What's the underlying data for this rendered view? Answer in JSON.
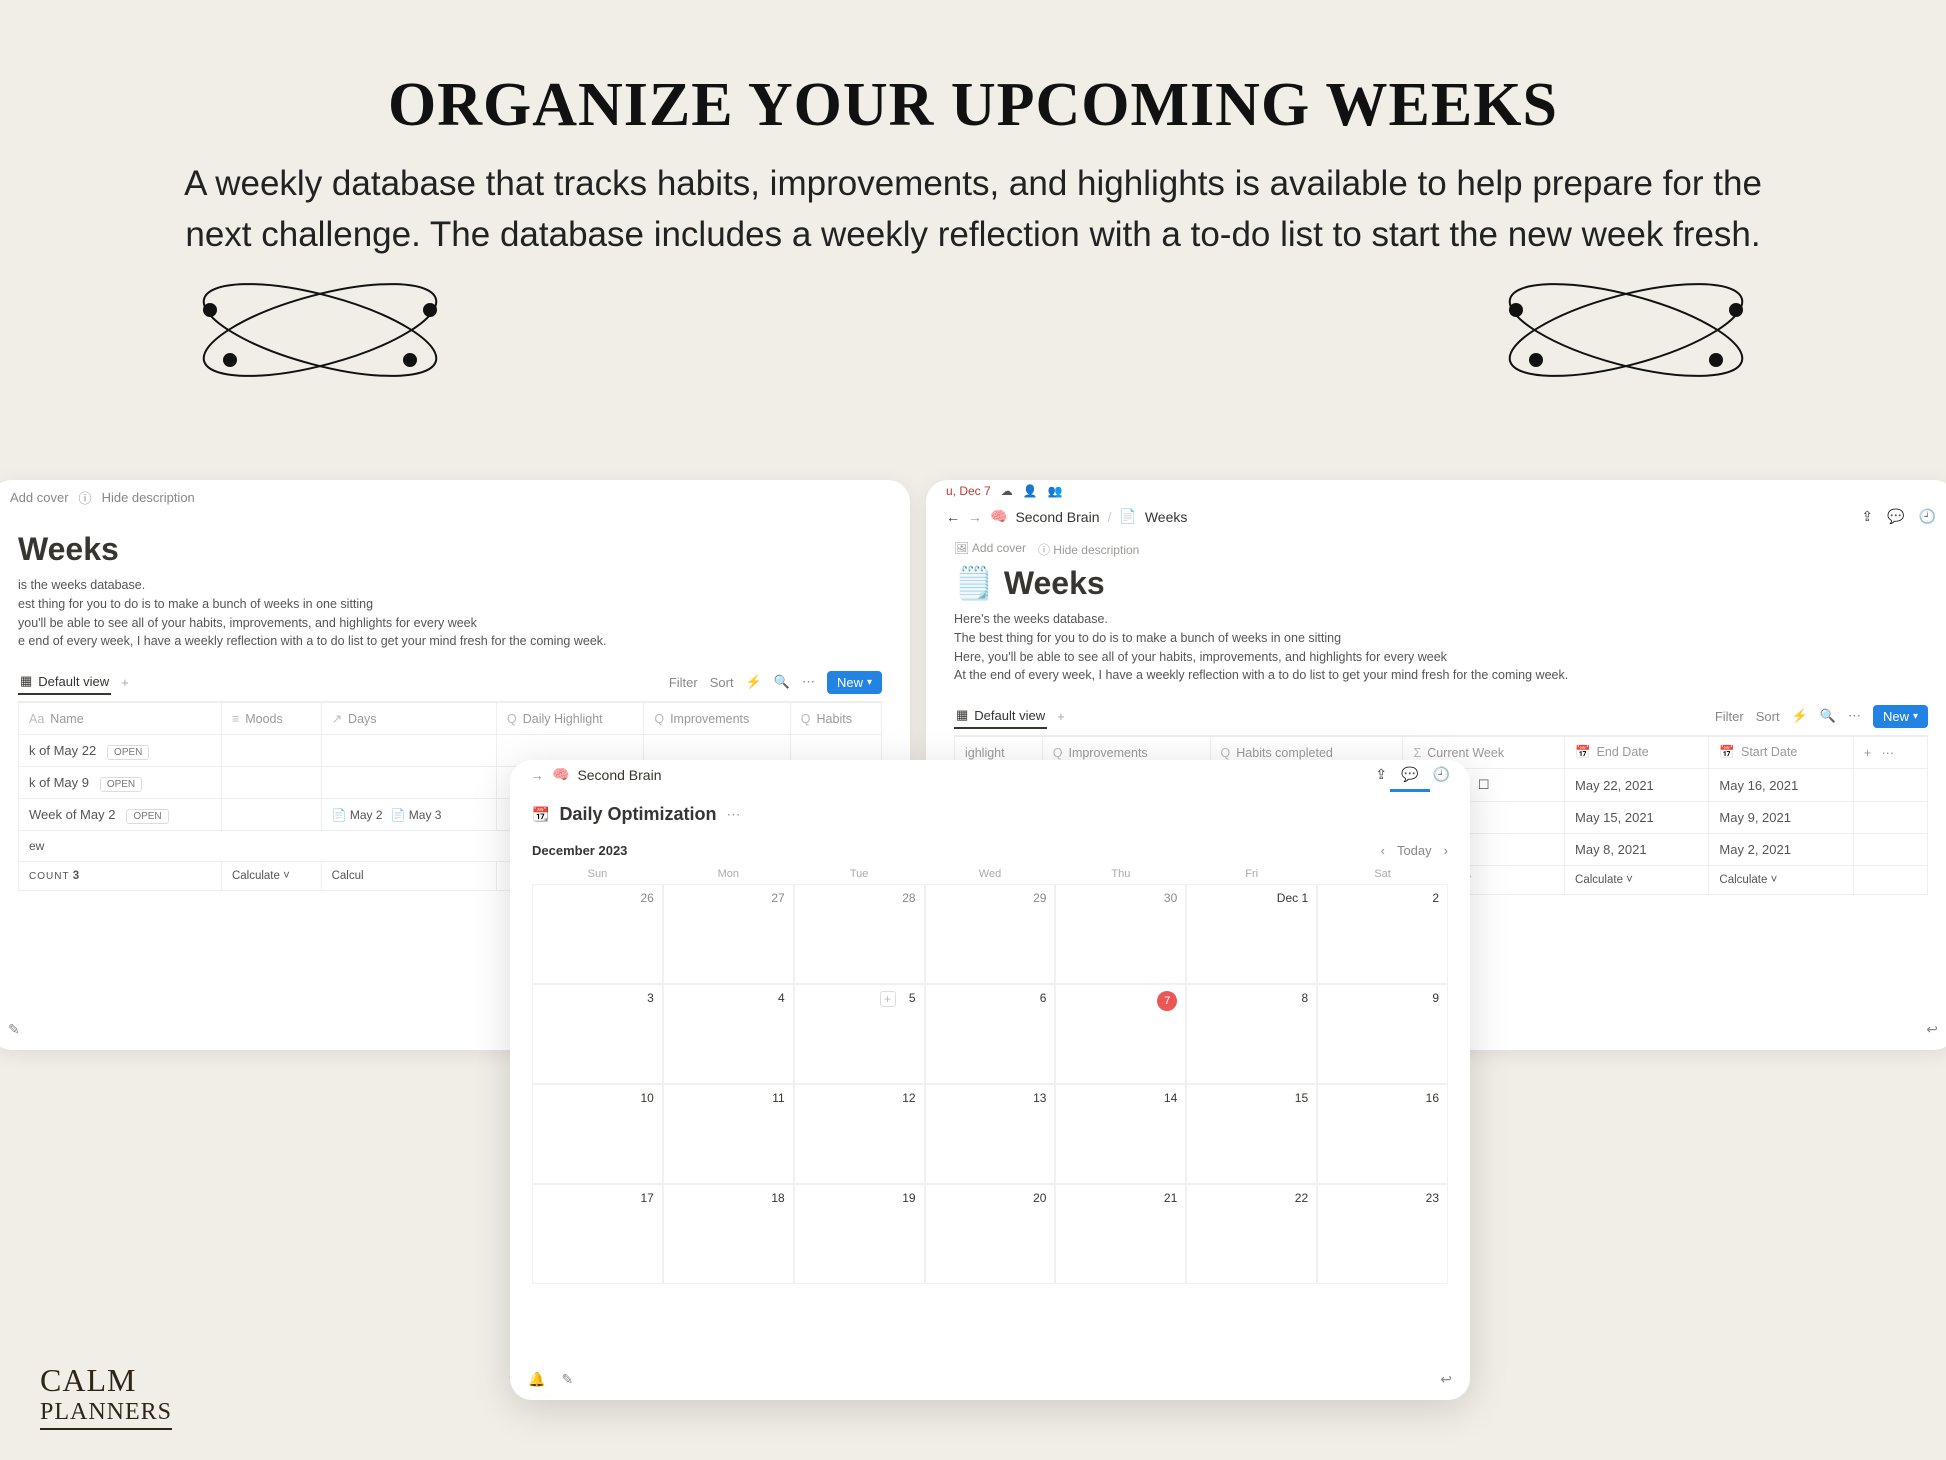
{
  "hero": {
    "title": "ORGANIZE YOUR UPCOMING WEEKS",
    "subtitle": "A weekly database that tracks habits, improvements, and highlights is available to help prepare for the next challenge. The database includes a weekly reflection with a to-do list to start the new week fresh."
  },
  "brand": {
    "line1": "CALM",
    "line2": "PLANNERS"
  },
  "left": {
    "add_cover": "Add cover",
    "hide_desc": "Hide description",
    "title": "Weeks",
    "desc1": "is the weeks database.",
    "desc2": "est thing for you to do is to make a bunch of weeks in one sitting",
    "desc3": "you'll be able to see all of your habits, improvements, and highlights for every week",
    "desc4": "e end of every week, I have a weekly reflection with a to do list to get your mind fresh for the coming week.",
    "default_view": "Default view",
    "filter": "Filter",
    "sort": "Sort",
    "new": "New",
    "headers": [
      "Name",
      "Moods",
      "Days",
      "Daily Highlight",
      "Improvements",
      "Habits"
    ],
    "rows": [
      {
        "name": "k of May 22",
        "open": "OPEN",
        "days": ""
      },
      {
        "name": "k of May 9",
        "open": "OPEN",
        "days": ""
      },
      {
        "name": "Week of May 2",
        "open": "OPEN",
        "days": "May 2  May 3"
      }
    ],
    "new_row": "ew",
    "count_label": "COUNT",
    "count_value": "3",
    "calculate": "Calculate"
  },
  "right": {
    "menubar_time": "u, Dec 7",
    "breadcrumb_app": "Second Brain",
    "breadcrumb_page": "Weeks",
    "add_cover": "Add cover",
    "hide_desc": "Hide description",
    "title": "Weeks",
    "desc1": "Here's the weeks database.",
    "desc2": "The best thing for you to do is to make a bunch of weeks in one sitting",
    "desc3": "Here, you'll be able to see all of your habits, improvements, and highlights for every week",
    "desc4": "At the end of every week, I have a weekly reflection with a to do list to get your mind fresh for the coming week.",
    "default_view": "Default view",
    "filter": "Filter",
    "sort": "Sort",
    "new": "New",
    "headers": [
      "ighlight",
      "Improvements",
      "Habits completed",
      "Current Week",
      "End Date",
      "Start Date"
    ],
    "rows": [
      {
        "end": "May 22, 2021",
        "start": "May 16, 2021"
      },
      {
        "end": "May 15, 2021",
        "start": "May 9, 2021"
      },
      {
        "end": "May 8, 2021",
        "start": "May 2, 2021"
      }
    ],
    "calculate": "Calculate"
  },
  "center": {
    "breadcrumb_app": "Second Brain",
    "title": "Daily Optimization",
    "month": "December 2023",
    "today": "Today",
    "dow": [
      "Sun",
      "Mon",
      "Tue",
      "Wed",
      "Thu",
      "Fri",
      "Sat"
    ],
    "weeks": [
      [
        "26",
        "27",
        "28",
        "29",
        "30",
        "Dec 1",
        "2"
      ],
      [
        "3",
        "4",
        "5",
        "6",
        "7",
        "8",
        "9"
      ],
      [
        "10",
        "11",
        "12",
        "13",
        "14",
        "15",
        "16"
      ],
      [
        "17",
        "18",
        "19",
        "20",
        "21",
        "22",
        "23"
      ]
    ],
    "today_value": "7",
    "add_hint_cell": "5"
  }
}
